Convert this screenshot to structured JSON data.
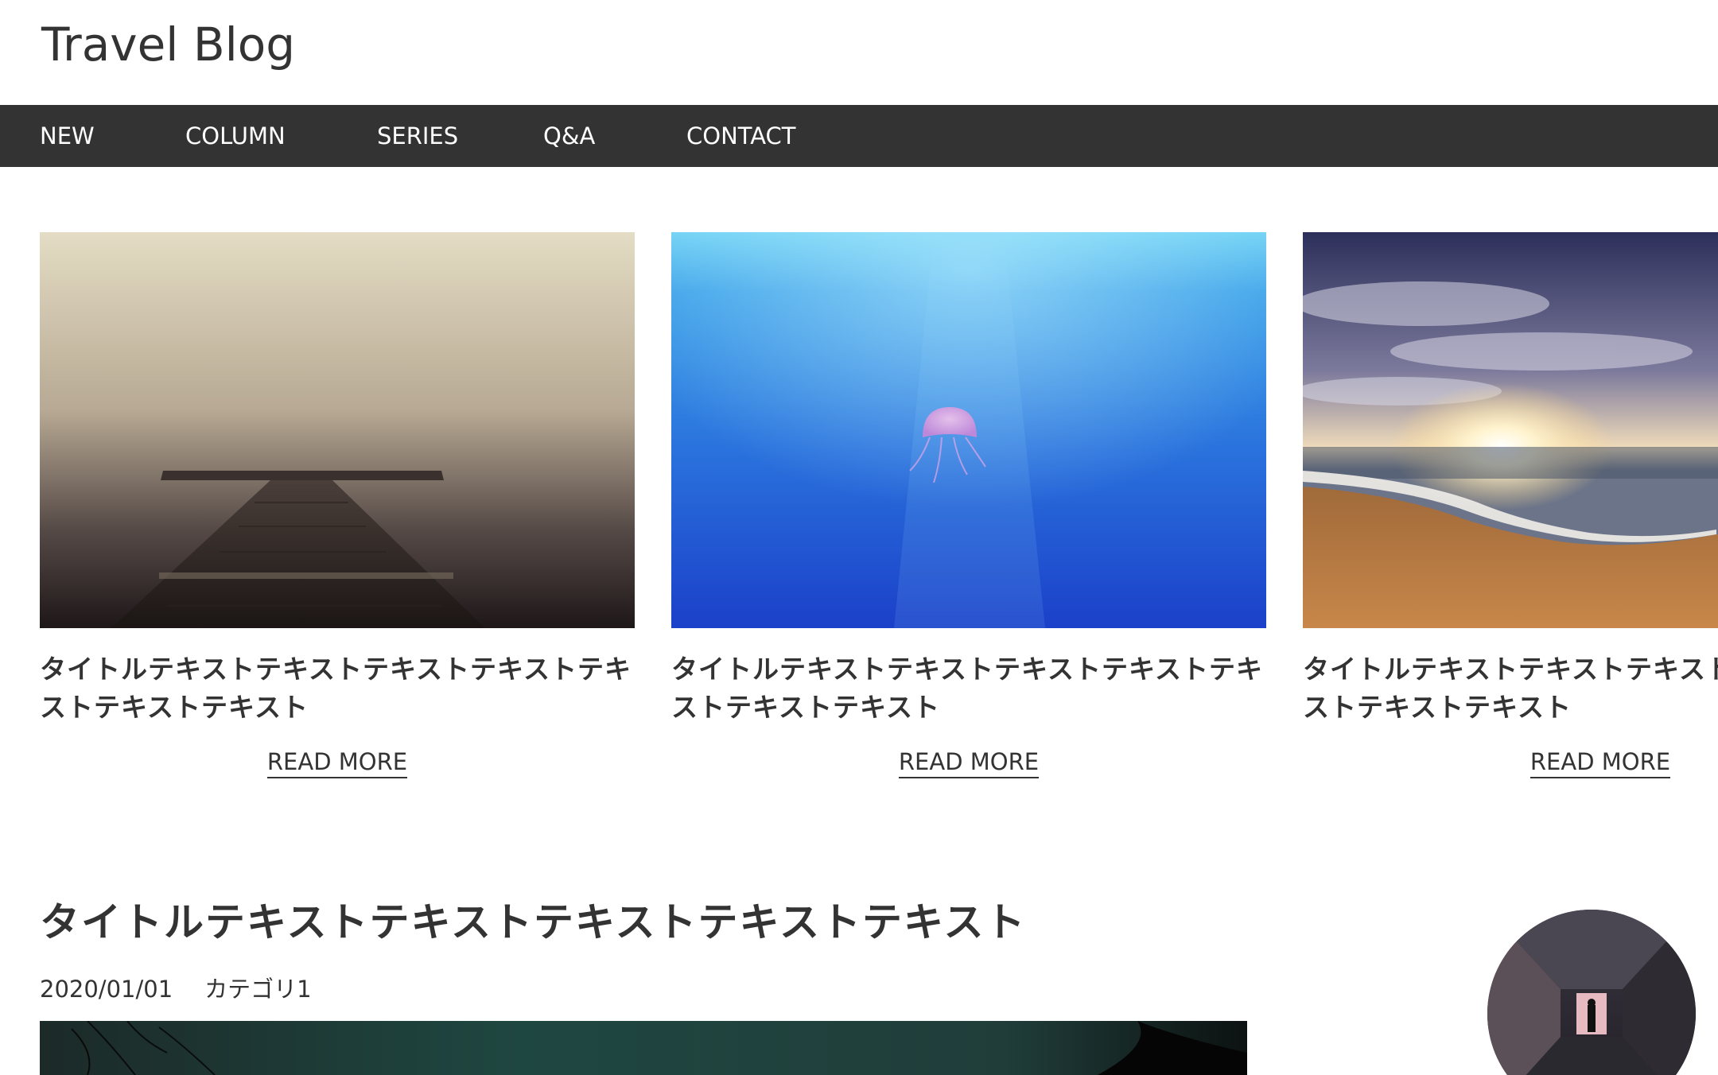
{
  "site": {
    "title": "Travel Blog"
  },
  "nav": {
    "items": [
      {
        "label": "NEW"
      },
      {
        "label": "COLUMN"
      },
      {
        "label": "SERIES"
      },
      {
        "label": "Q&A"
      },
      {
        "label": "CONTACT"
      }
    ]
  },
  "cards": [
    {
      "title": "タイトルテキストテキストテキストテキストテキストテキストテキスト",
      "read_more": "READ MORE",
      "image": "foggy-pier-photo"
    },
    {
      "title": "タイトルテキストテキストテキストテキストテキストテキストテキスト",
      "read_more": "READ MORE",
      "image": "jellyfish-underwater-photo"
    },
    {
      "title": "タイトルテキストテキストテキストテキストテキストテキストテキスト",
      "read_more": "READ MORE",
      "image": "beach-sunset-photo"
    }
  ],
  "article": {
    "title": "タイトルテキストテキストテキストテキストテキスト",
    "date": "2020/01/01",
    "category": "カテゴリ1",
    "image": "night-sky-photo"
  },
  "profile": {
    "image": "corridor-photo"
  },
  "colors": {
    "nav_bg": "#333333",
    "text": "#333333",
    "background": "#ffffff"
  }
}
